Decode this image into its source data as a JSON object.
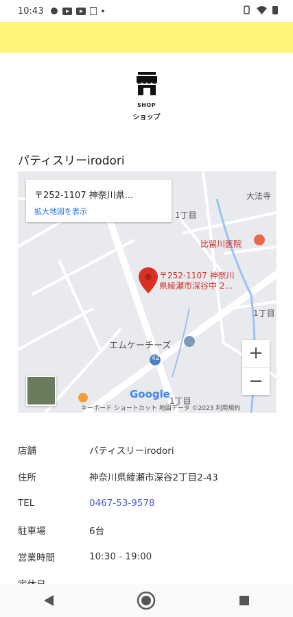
{
  "status_bar": {
    "time": "10:43"
  },
  "shop_header": {
    "en": "SHOP",
    "jp": "ショップ"
  },
  "shop_name": "パティスリーirodori",
  "map": {
    "card_address": "〒252-1107 神奈川県...",
    "card_link": "拡大地図を表示",
    "pin_label_line1": "〒252-1107 神奈川",
    "pin_label_line2": "県綾瀬市深谷中 2…",
    "labels": {
      "daihoji": "大法寺",
      "hirukawa": "比留川医院",
      "itchome_a": "1丁目",
      "itchome_b": "1丁目",
      "itchome_c": "1丁目",
      "mk": "エムケーチーズ",
      "route": "42"
    },
    "zoom_in": "+",
    "zoom_out": "−",
    "google": "Google",
    "footer": "キーボード ショートカット    地図データ ©2023    利用規約"
  },
  "info_rows": [
    {
      "key": "店舗",
      "value": "パティスリーirodori"
    },
    {
      "key": "住所",
      "value": "神奈川県綾瀬市深谷2丁目2-43"
    },
    {
      "key": "TEL",
      "value": "0467-53-9578"
    },
    {
      "key": "駐車場",
      "value": "6台"
    },
    {
      "key": "営業時間",
      "value": "10:30 - 19:00"
    },
    {
      "key": "定休日",
      "value": ""
    }
  ]
}
